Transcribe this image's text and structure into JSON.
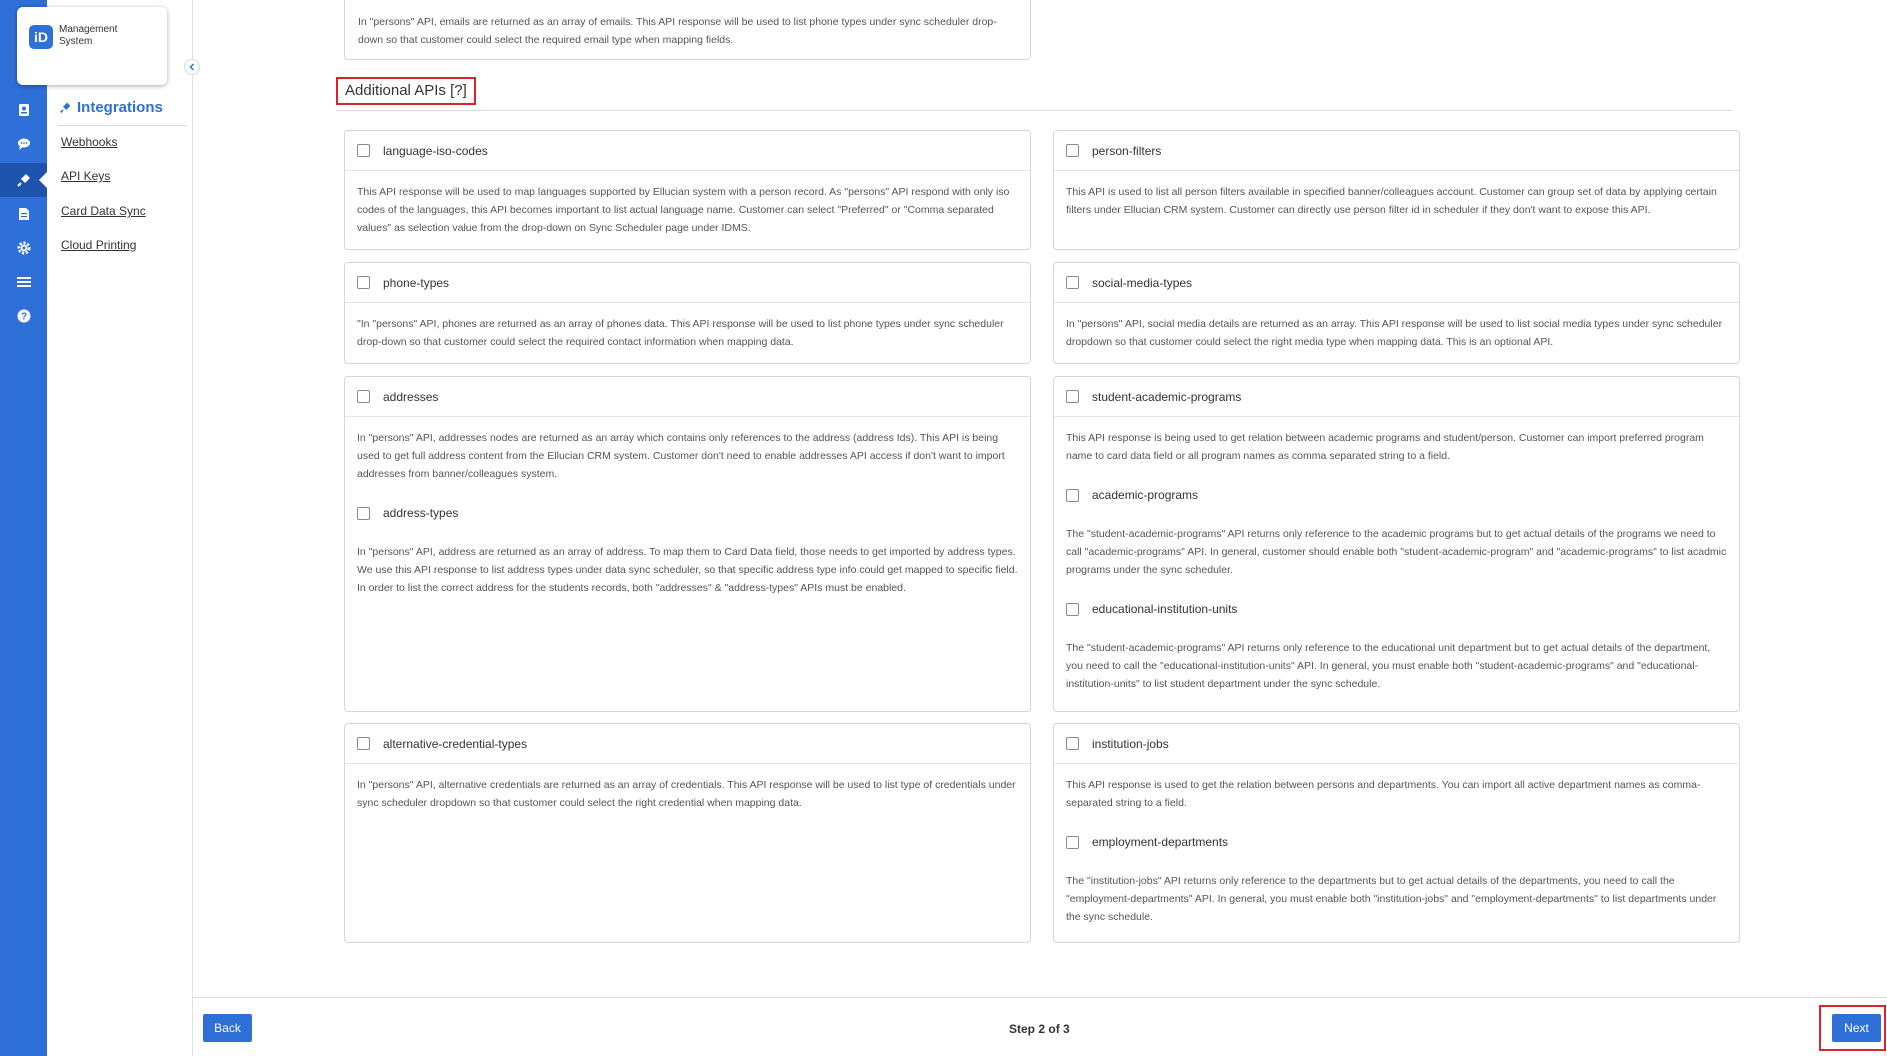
{
  "logo": {
    "mark": "iD",
    "line1": "Management",
    "line2": "System"
  },
  "rail": {
    "icons": [
      "badge-icon",
      "chat-icon",
      "plug-icon",
      "document-icon",
      "gear-icon",
      "list-icon",
      "help-icon"
    ],
    "active": "plug-icon"
  },
  "subnav": {
    "title": "Integrations",
    "items": [
      {
        "label": "Webhooks"
      },
      {
        "label": "API Keys"
      },
      {
        "label": "Card Data Sync"
      },
      {
        "label": "Cloud Printing"
      }
    ]
  },
  "top_card": {
    "desc": "In \"persons\" API, emails are returned as an array of emails. This API response will be used to list phone types under sync scheduler drop-down so that customer could select the required email type when mapping fields."
  },
  "section": {
    "title": "Additional APIs [?]"
  },
  "cards": {
    "language_iso_codes": {
      "label": "language-iso-codes",
      "desc": "This API response will be used to map languages supported by Ellucian system with a person record. As \"persons\" API respond with only iso codes of the languages, this API becomes important to list actual language name. Customer can select \"Preferred\" or \"Comma separated values\" as selection value from the drop-down on Sync Scheduler page under IDMS."
    },
    "person_filters": {
      "label": "person-filters",
      "desc": "This API is used to list all person filters available in specified banner/colleagues account. Customer can group set of data by applying certain filters under Ellucian CRM system. Customer can directly use person filter id in scheduler if they don't want to expose this API."
    },
    "phone_types": {
      "label": "phone-types",
      "desc": "\"In \"persons\" API, phones are returned as an array of phones data. This API response will be used to list phone types under sync scheduler drop-down so that customer could select the required contact information when mapping data."
    },
    "social_media_types": {
      "label": "social-media-types",
      "desc": "In \"persons\" API, social media details are returned as an array. This API response will be used to list social media types under sync scheduler dropdown so that customer could select the right media type when mapping data. This is an optional API."
    },
    "addresses": {
      "label": "addresses",
      "desc": "In \"persons\" API, addresses nodes are returned as an array which contains only references to the address (address Ids). This API is being used to get full address content from the Ellucian CRM system. Customer don't need to enable addresses API access if don't want to import addresses from banner/colleagues system."
    },
    "address_types": {
      "label": "address-types",
      "desc": "In \"persons\" API, address are returned as an array of address. To map them to Card Data field, those needs to get imported by address types. We use this API response to list address types under data sync scheduler, so that specific address type info could get mapped to specific field. In order to list the correct address for the students records, both \"addresses\" & \"address-types\" APIs must be enabled."
    },
    "student_academic_programs": {
      "label": "student-academic-programs",
      "desc": "This API response is being used to get relation between academic programs and student/person. Customer can import preferred program name to card data field or all program names as comma separated string to a field."
    },
    "academic_programs": {
      "label": "academic-programs",
      "desc": "The \"student-academic-programs\" API returns only reference to the academic programs but to get actual details of the programs we need to call \"academic-programs\" API. In general, customer should enable both \"student-academic-program\" and \"academic-programs\" to list acadmic programs under the sync scheduler."
    },
    "educational_institution_units": {
      "label": "educational-institution-units",
      "desc": "The \"student-academic-programs\" API returns only reference to the educational unit department but to get actual details of the department, you need to call the \"educational-institution-units\" API. In general, you must enable both \"student-academic-programs\" and \"educational-institution-units\" to list student department under the sync schedule."
    },
    "alternative_credential_types": {
      "label": "alternative-credential-types",
      "desc": "In \"persons\" API, alternative credentials are returned as an array of credentials. This API response will be used to list type of credentials under sync scheduler dropdown so that customer could select the right credential when mapping data."
    },
    "institution_jobs": {
      "label": "institution-jobs",
      "desc": "This API response is used to get the relation between persons and departments. You can import all active department names as comma-separated string to a field."
    },
    "employment_departments": {
      "label": "employment-departments",
      "desc": "The \"institution-jobs\" API returns only reference to the departments but to get actual details of the departments, you need to call the \"employment-departments\" API. In general, you must enable both \"institution-jobs\" and \"employment-departments\" to list departments under the sync schedule."
    }
  },
  "footer": {
    "back_label": "Back",
    "step_prefix": "Step ",
    "step_current": "2",
    "step_suffix": " of 3",
    "next_label": "Next"
  },
  "colors": {
    "primary": "#2f6fd8",
    "highlight": "#d9232f"
  }
}
